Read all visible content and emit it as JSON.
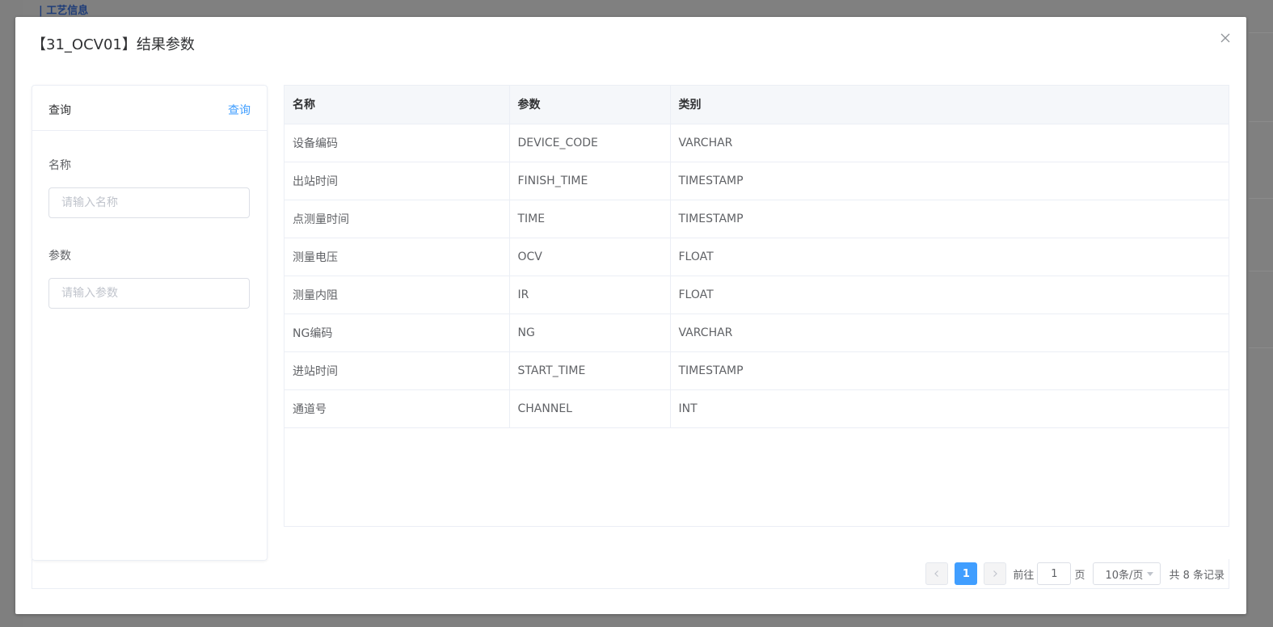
{
  "background": {
    "section_label": "| 工艺信息"
  },
  "dialog": {
    "title": "【31_OCV01】结果参数"
  },
  "query_panel": {
    "header_title": "查询",
    "query_button": "查询",
    "fields": [
      {
        "label": "名称",
        "placeholder": "请输入名称"
      },
      {
        "label": "参数",
        "placeholder": "请输入参数"
      }
    ]
  },
  "table": {
    "columns": [
      "名称",
      "参数",
      "类别"
    ],
    "rows": [
      [
        "设备编码",
        "DEVICE_CODE",
        "VARCHAR"
      ],
      [
        "出站时间",
        "FINISH_TIME",
        "TIMESTAMP"
      ],
      [
        "点测量时间",
        "TIME",
        "TIMESTAMP"
      ],
      [
        "测量电压",
        "OCV",
        "FLOAT"
      ],
      [
        "测量内阻",
        "IR",
        "FLOAT"
      ],
      [
        "NG编码",
        "NG",
        "VARCHAR"
      ],
      [
        "进站时间",
        "START_TIME",
        "TIMESTAMP"
      ],
      [
        "通道号",
        "CHANNEL",
        "INT"
      ]
    ]
  },
  "pagination": {
    "current_page": "1",
    "goto_label": "前往",
    "goto_value": "1",
    "page_suffix": "页",
    "page_size": "10条/页",
    "total": "共 8 条记录"
  },
  "colors": {
    "primary": "#409eff",
    "text": "#606266",
    "border": "#ebeef5"
  }
}
